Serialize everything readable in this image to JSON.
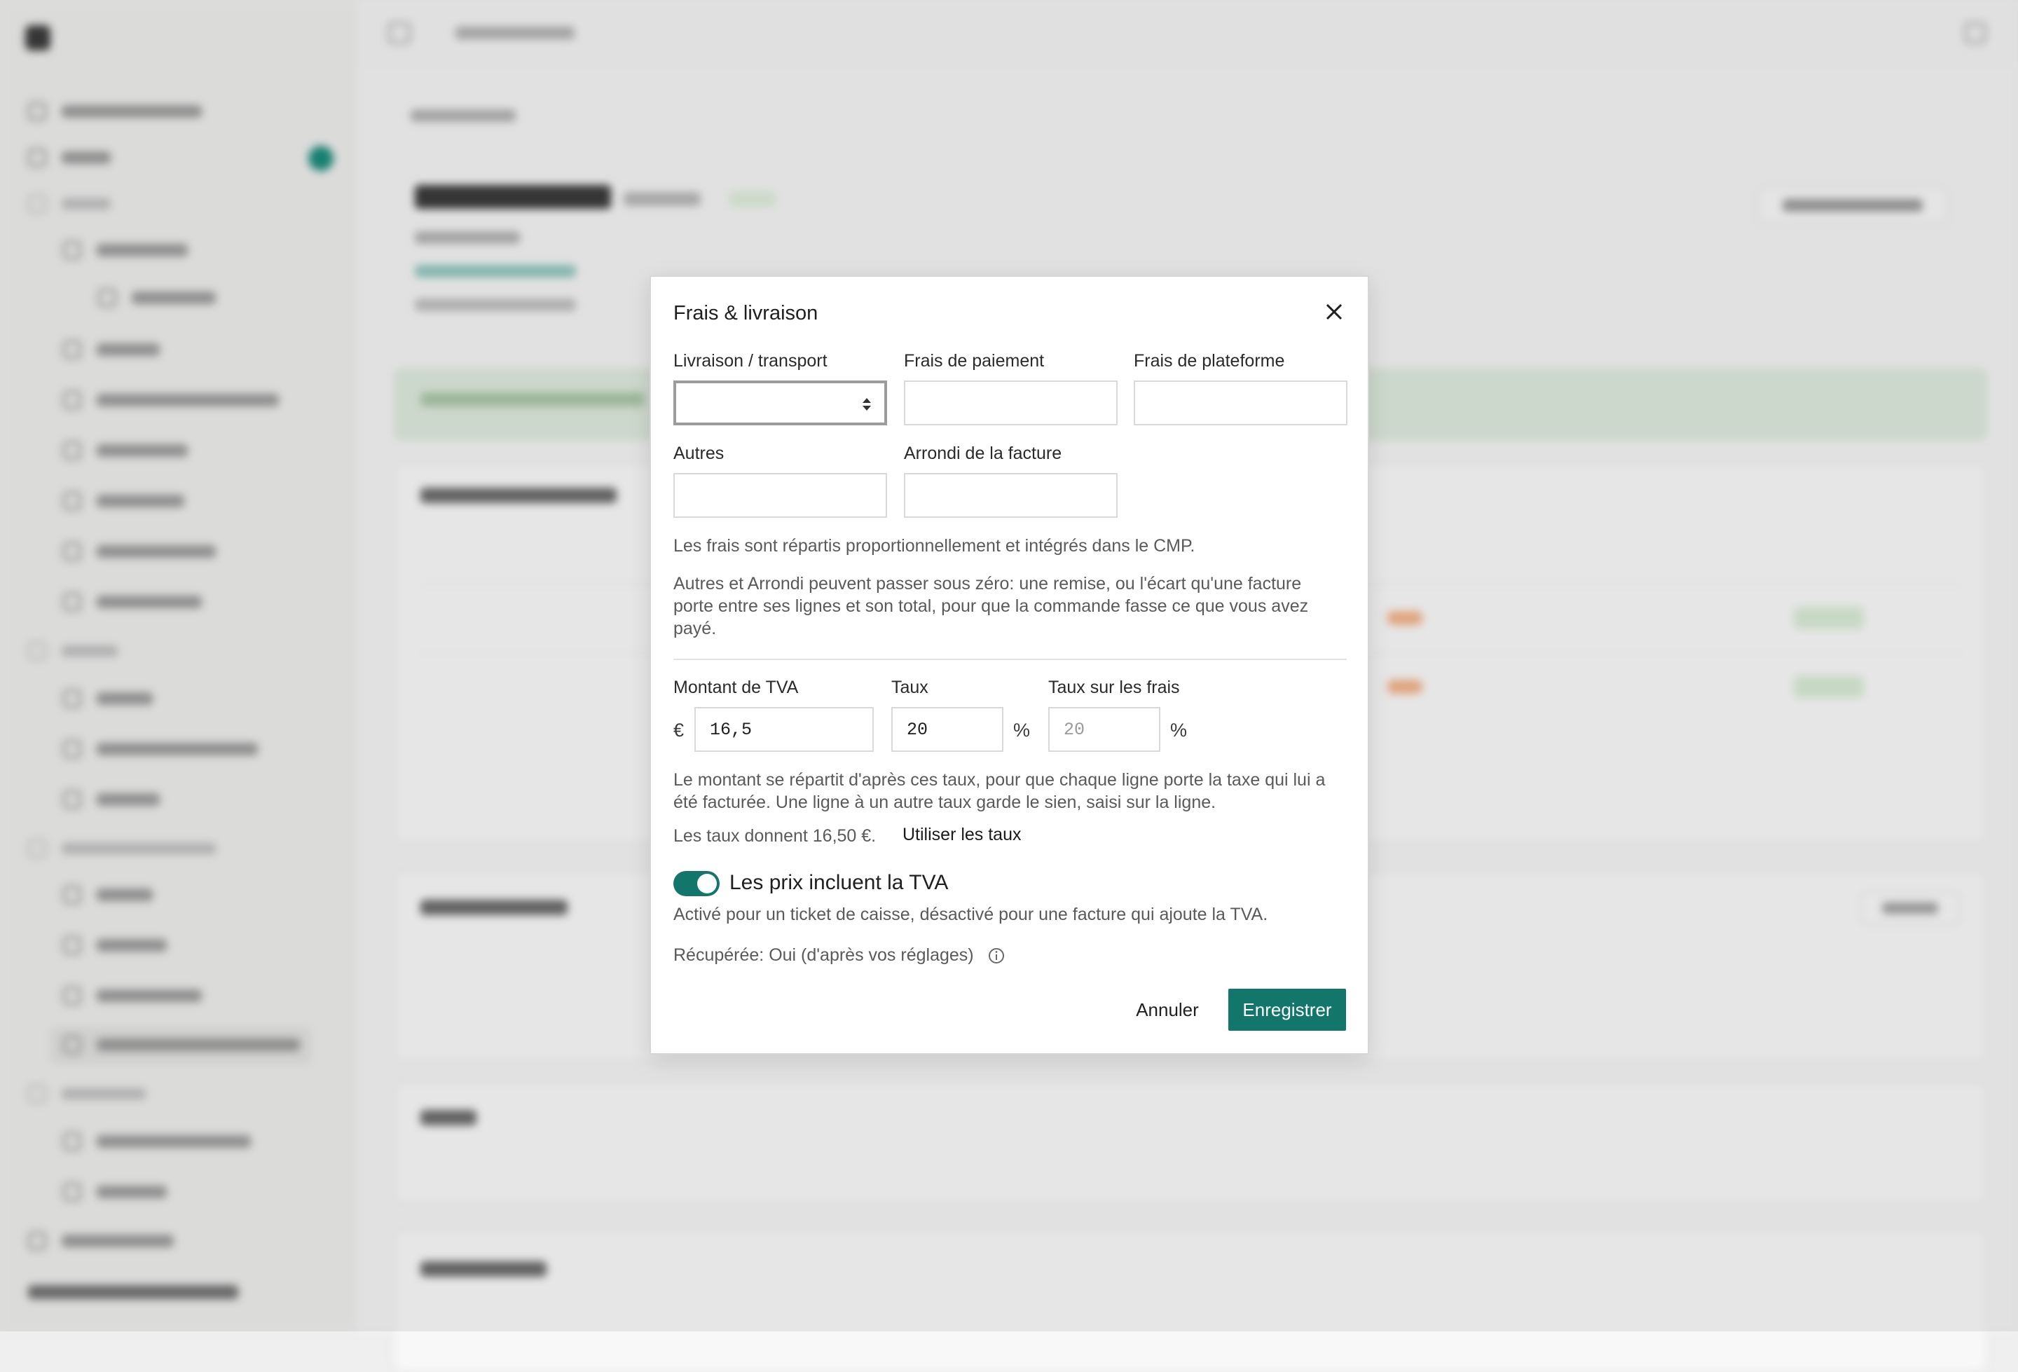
{
  "dialog": {
    "title": "Frais & livraison",
    "close_icon": "close-icon",
    "fields": {
      "shipping": {
        "label": "Livraison / transport",
        "value": ""
      },
      "payment": {
        "label": "Frais de paiement",
        "value": ""
      },
      "platform": {
        "label": "Frais de plateforme",
        "value": ""
      },
      "other": {
        "label": "Autres",
        "value": ""
      },
      "rounding": {
        "label": "Arrondi de la facture",
        "value": ""
      }
    },
    "hint_prorata": "Les frais sont répartis proportionnellement et intégrés dans le CMP.",
    "hint_negative": "Autres et Arrondi peuvent passer sous zéro: une remise, ou l'écart qu'une facture porte entre ses lignes et son total, pour que la commande fasse ce que vous avez payé.",
    "vat": {
      "amount_label": "Montant de TVA",
      "currency": "€",
      "amount_value": "16,5",
      "rate_label": "Taux",
      "rate_value": "20",
      "percent": "%",
      "fee_rate_label": "Taux sur les frais",
      "fee_rate_placeholder": "20"
    },
    "hint_split": "Le montant se répartit d'après ces taux, pour que chaque ligne porte la taxe qui lui a été facturée. Une ligne à un autre taux garde le sien, saisi sur la ligne.",
    "rates_give": "Les taux donnent 16,50 €.",
    "use_rates": "Utiliser les taux",
    "toggle": {
      "label": "Les prix incluent la TVA",
      "on": true
    },
    "toggle_hint": "Activé pour un ticket de caisse, désactivé pour une facture qui ajoute la TVA.",
    "recovered": "Récupérée: Oui (d'après vos réglages)",
    "cancel": "Annuler",
    "save": "Enregistrer"
  },
  "colors": {
    "accent": "#13766b",
    "brand": "#1a8a7a"
  }
}
